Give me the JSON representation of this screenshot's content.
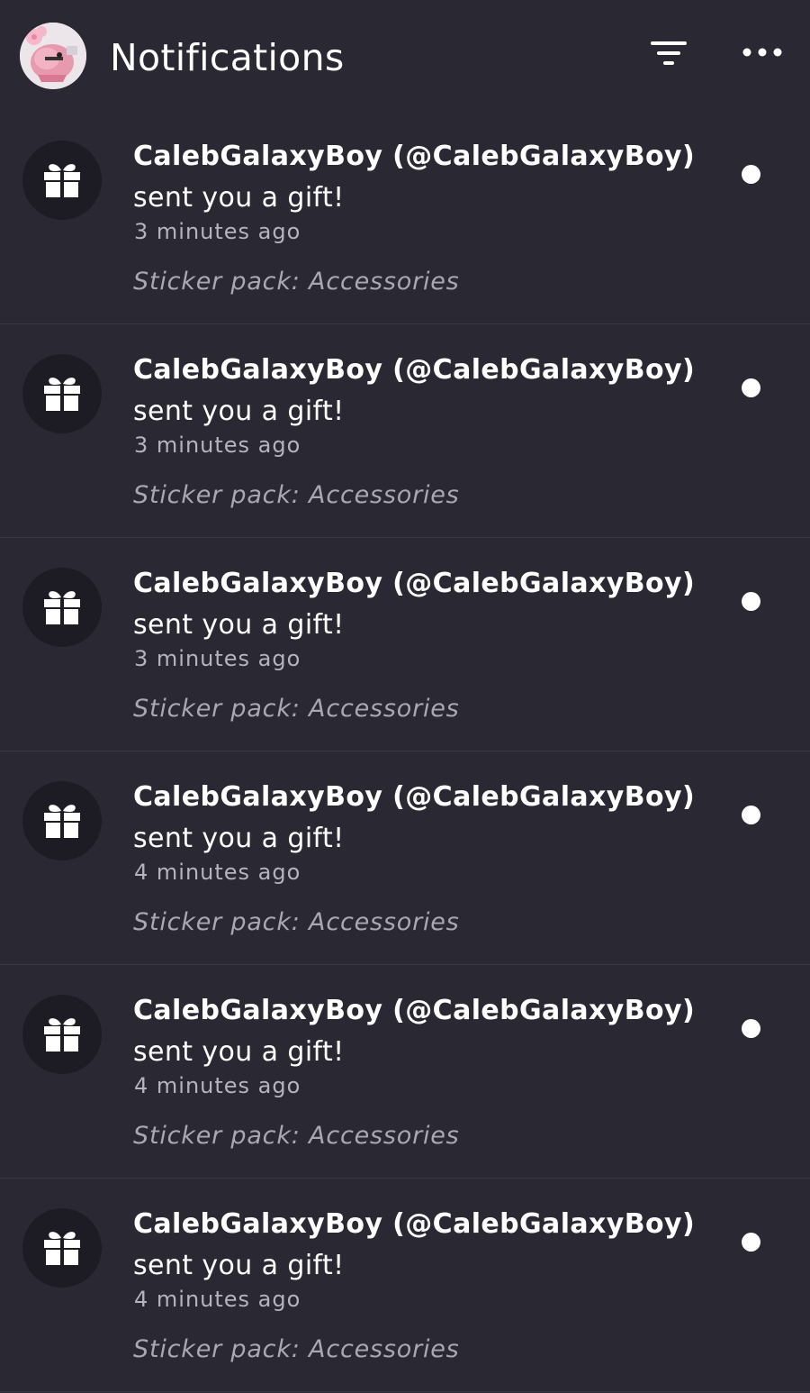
{
  "header": {
    "title": "Notifications",
    "avatar_icon": "profile-avatar",
    "filter_icon": "filter-icon",
    "more_icon": "more-options-icon"
  },
  "notifications": [
    {
      "sender": "CalebGalaxyBoy (@CalebGalaxyBoy)",
      "action": " sent you a gift!",
      "time": "3 minutes ago",
      "detail": "Sticker pack: Accessories",
      "unread": true
    },
    {
      "sender": "CalebGalaxyBoy (@CalebGalaxyBoy)",
      "action": " sent you a gift!",
      "time": "3 minutes ago",
      "detail": "Sticker pack: Accessories",
      "unread": true
    },
    {
      "sender": "CalebGalaxyBoy (@CalebGalaxyBoy)",
      "action": " sent you a gift!",
      "time": "3 minutes ago",
      "detail": "Sticker pack: Accessories",
      "unread": true
    },
    {
      "sender": "CalebGalaxyBoy (@CalebGalaxyBoy)",
      "action": " sent you a gift!",
      "time": "4 minutes ago",
      "detail": "Sticker pack: Accessories",
      "unread": true
    },
    {
      "sender": "CalebGalaxyBoy (@CalebGalaxyBoy)",
      "action": " sent you a gift!",
      "time": "4 minutes ago",
      "detail": "Sticker pack: Accessories",
      "unread": true
    },
    {
      "sender": "CalebGalaxyBoy (@CalebGalaxyBoy)",
      "action": " sent you a gift!",
      "time": "4 minutes ago",
      "detail": "Sticker pack: Accessories",
      "unread": true
    }
  ],
  "colors": {
    "background": "#2a2833",
    "icon_circle": "#1d1c24",
    "text_primary": "#ffffff",
    "text_secondary": "#b5b3bd"
  }
}
